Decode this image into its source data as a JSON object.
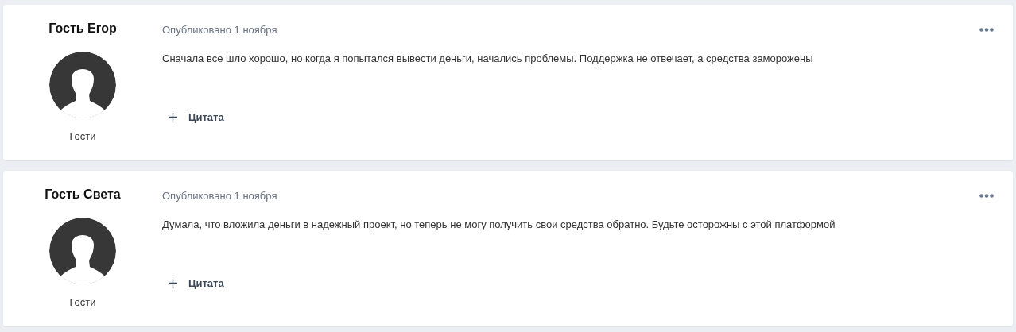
{
  "posts": [
    {
      "author": "Гость Егор",
      "group": "Гости",
      "date": "Опубликовано 1 ноября",
      "text": "Сначала все шло хорошо, но когда я попытался вывести деньги, начались проблемы. Поддержка не отвечает, а средства заморожены",
      "quote_label": "Цитата"
    },
    {
      "author": "Гость Света",
      "group": "Гости",
      "date": "Опубликовано 1 ноября",
      "text": "Думала, что вложила деньги в надежный проект, но теперь не могу получить свои средства обратно. Будьте осторожны с этой платформой",
      "quote_label": "Цитата"
    }
  ]
}
